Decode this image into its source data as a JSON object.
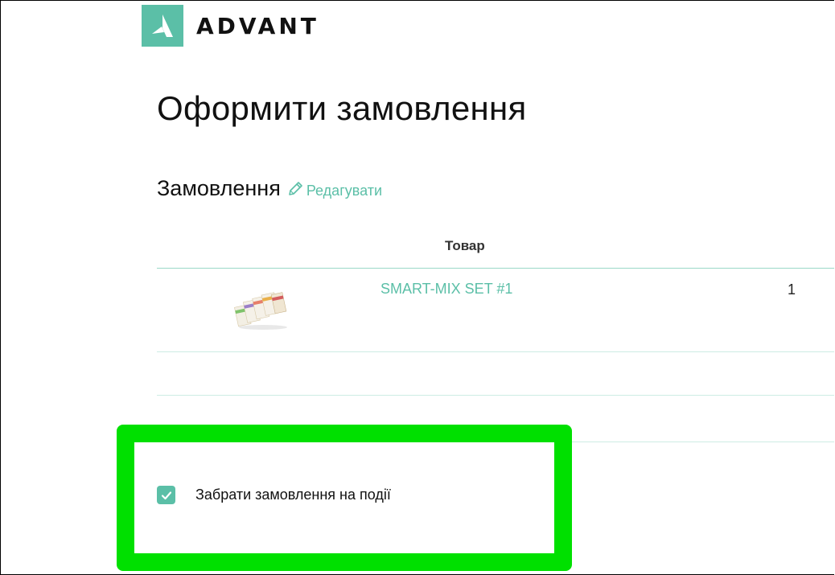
{
  "header": {
    "logo_text": "ADVANT",
    "logo_icon": "advant-logo-icon"
  },
  "page": {
    "title": "Оформити замовлення"
  },
  "order_section": {
    "title": "Замовлення",
    "edit_label": "Редагувати",
    "edit_icon": "pencil-icon"
  },
  "table": {
    "header_product": "Товар",
    "rows": [
      {
        "name": "SMART-MIX SET #1",
        "quantity": "1",
        "thumbnail": "product-thumbnail"
      }
    ]
  },
  "pickup": {
    "label": "Забрати замовлення на події",
    "checked": true
  },
  "colors": {
    "accent": "#5bbfa7",
    "highlight": "#00e000"
  }
}
